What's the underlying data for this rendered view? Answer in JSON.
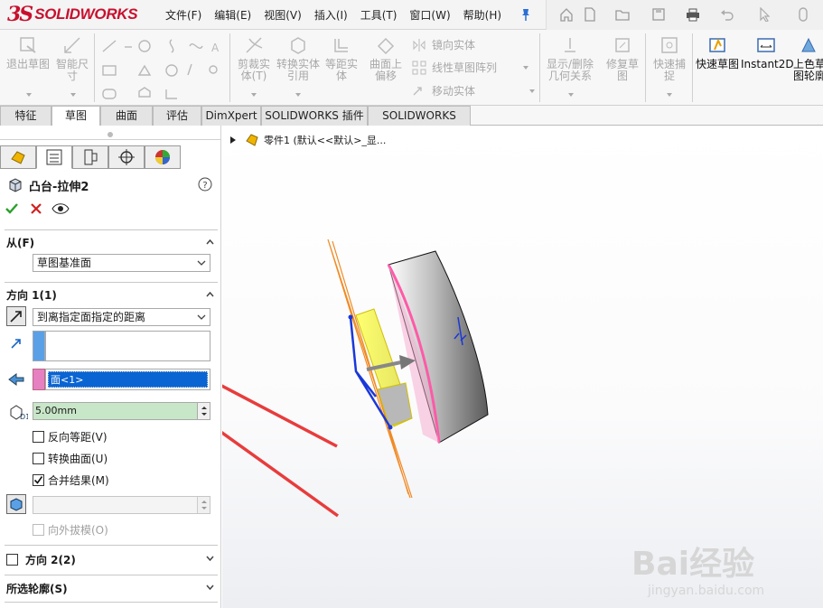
{
  "app": {
    "logo_ds": "3S",
    "logo_text": "SOLIDWORKS"
  },
  "menu": [
    "文件(F)",
    "编辑(E)",
    "视图(V)",
    "插入(I)",
    "工具(T)",
    "窗口(W)",
    "帮助(H)"
  ],
  "toolbar": {
    "exit_sketch": "退出草图",
    "smart_dim": "智能尺寸",
    "trim": "剪裁实体(T)",
    "convert": "转换实体引用",
    "offset": "等距实体",
    "offset_surface": "曲面上偏移",
    "mirror": "镜向实体",
    "linear_pattern": "线性草图阵列",
    "move": "移动实体",
    "display_delete": "显示/删除几何关系",
    "repair": "修复草图",
    "quick_snap": "快速捕捉",
    "rapid_sketch": "快速草图",
    "instant2d": "Instant2D",
    "shaded_contours": "上色草图轮廓"
  },
  "tabs": [
    "特征",
    "草图",
    "曲面",
    "评估",
    "DimXpert",
    "SOLIDWORKS 插件",
    "SOLIDWORKS MBD"
  ],
  "active_tab": "草图",
  "feature": {
    "title": "凸台-拉伸2"
  },
  "from": {
    "label": "从(F)",
    "value": "草图基准面"
  },
  "direction1": {
    "label": "方向 1(1)",
    "end_condition": "到离指定面指定的距离",
    "face_value": "面<1>",
    "distance": "5.00mm",
    "reverse_offset": "反向等距(V)",
    "translate_surface": "转换曲面(U)",
    "merge_result": "合并结果(M)",
    "draft_outward": "向外拔模(O)"
  },
  "direction2": {
    "label": "方向 2(2)"
  },
  "selected_contours": {
    "label": "所选轮廓(S)"
  },
  "tree": {
    "root": "零件1  (默认<<默认>_显..."
  },
  "watermark": {
    "main": "Bai经验",
    "sub": "jingyan.baidu.com"
  },
  "colors": {
    "selection_blue": "#0a64d2",
    "highlight_green": "#c8e6c8",
    "pink_swatch": "#e680c0",
    "blue_swatch": "#5aa0e6",
    "arrow_red": "#e83c3c",
    "logo_red": "#c8102e"
  }
}
